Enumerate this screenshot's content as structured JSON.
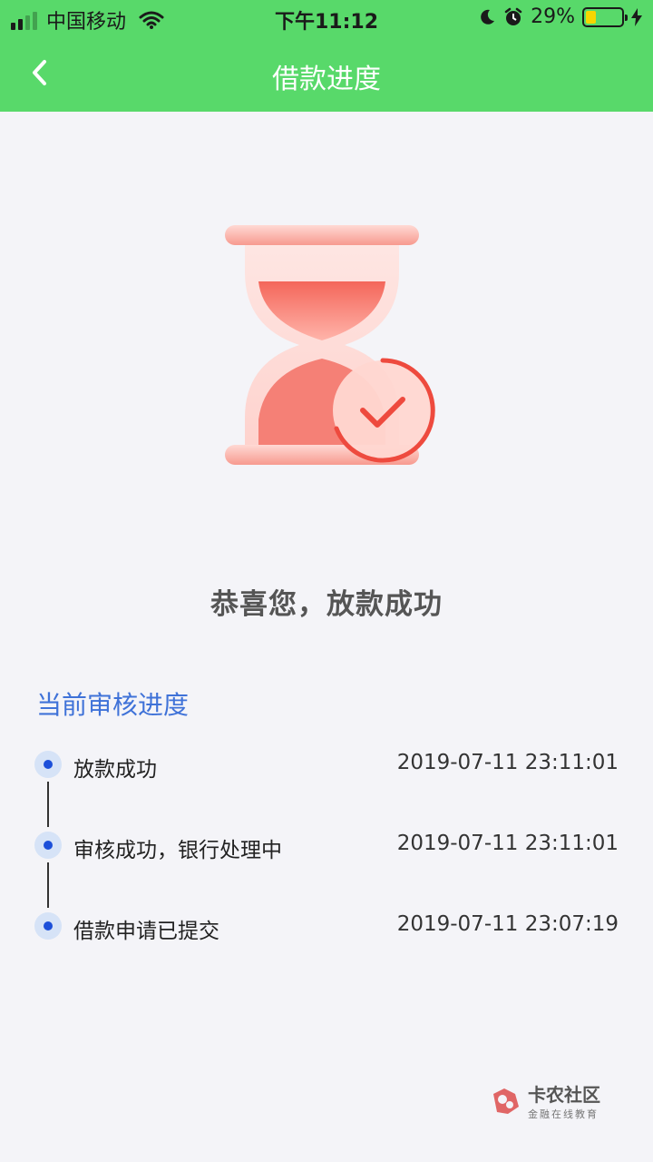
{
  "status_bar": {
    "carrier": "中国移动",
    "time": "下午11:12",
    "battery_text": "29%",
    "battery_level": 0.29
  },
  "nav": {
    "title": "借款进度"
  },
  "result": {
    "message": "恭喜您，放款成功"
  },
  "progress": {
    "section_title": "当前审核进度",
    "steps": [
      {
        "label": "放款成功",
        "time": "2019-07-11 23:11:01"
      },
      {
        "label": "审核成功，银行处理中",
        "time": "2019-07-11 23:11:01"
      },
      {
        "label": "借款申请已提交",
        "time": "2019-07-11 23:07:19"
      }
    ]
  },
  "watermark": {
    "main": "卡农社区",
    "sub": "金融在线教育"
  },
  "colors": {
    "header": "#58d96a",
    "accent_blue": "#3f72d8",
    "dot_blue": "#1c4fd9",
    "hourglass_red": "#f26a5e"
  }
}
